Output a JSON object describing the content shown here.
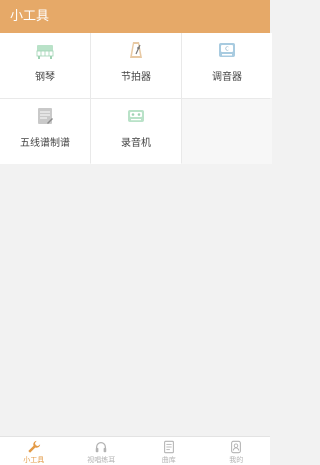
{
  "header": {
    "title": "小工具"
  },
  "tools": [
    {
      "label": "钢琴",
      "icon": "piano-icon"
    },
    {
      "label": "节拍器",
      "icon": "metronome-icon"
    },
    {
      "label": "调音器",
      "icon": "tuner-icon"
    },
    {
      "label": "五线谱制谱",
      "icon": "staff-notation-icon"
    },
    {
      "label": "录音机",
      "icon": "recorder-icon"
    }
  ],
  "tabbar": {
    "items": [
      {
        "label": "小工具",
        "icon": "wrench-icon",
        "active": true
      },
      {
        "label": "视唱练耳",
        "icon": "headphones-icon",
        "active": false
      },
      {
        "label": "曲库",
        "icon": "sheet-music-icon",
        "active": false
      },
      {
        "label": "我的",
        "icon": "profile-icon",
        "active": false
      }
    ]
  },
  "colors": {
    "header_bg": "#e6a968",
    "accent": "#e39a46",
    "icon_green": "#9fd3b3",
    "icon_blue": "#a8cbe0",
    "inactive": "#b3b3b3"
  }
}
